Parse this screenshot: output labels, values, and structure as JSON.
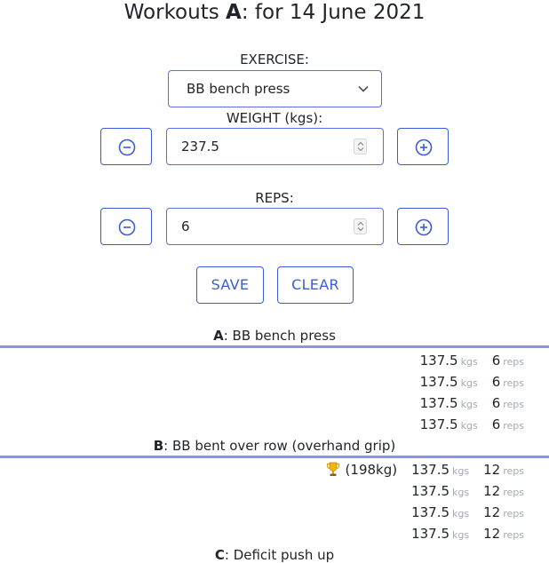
{
  "header": {
    "prefix": "Workouts ",
    "letter": "A",
    "suffix": ": for 14 June 2021"
  },
  "form": {
    "exercise_label": "EXERCISE:",
    "exercise_value": "BB bench press",
    "weight_label": "WEIGHT (kgs):",
    "weight_value": "237.5",
    "reps_label": "REPS:",
    "reps_value": "6",
    "save_label": "SAVE",
    "clear_label": "CLEAR"
  },
  "groups": [
    {
      "letter": "A",
      "name": ": BB bench press",
      "sets": [
        {
          "weight": "137.5",
          "weight_unit": "kgs",
          "reps": "6",
          "reps_unit": "reps"
        },
        {
          "weight": "137.5",
          "weight_unit": "kgs",
          "reps": "6",
          "reps_unit": "reps"
        },
        {
          "weight": "137.5",
          "weight_unit": "kgs",
          "reps": "6",
          "reps_unit": "reps"
        },
        {
          "weight": "137.5",
          "weight_unit": "kgs",
          "reps": "6",
          "reps_unit": "reps"
        }
      ]
    },
    {
      "letter": "B",
      "name": ": BB bent over row (overhand grip)",
      "personal_best": "(198kg)",
      "sets": [
        {
          "weight": "137.5",
          "weight_unit": "kgs",
          "reps": "12",
          "reps_unit": "reps"
        },
        {
          "weight": "137.5",
          "weight_unit": "kgs",
          "reps": "12",
          "reps_unit": "reps"
        },
        {
          "weight": "137.5",
          "weight_unit": "kgs",
          "reps": "12",
          "reps_unit": "reps"
        },
        {
          "weight": "137.5",
          "weight_unit": "kgs",
          "reps": "12",
          "reps_unit": "reps"
        }
      ]
    },
    {
      "letter": "C",
      "name": ": Deficit push up",
      "sets": []
    }
  ],
  "icons": {
    "minus": "minus-circle-icon",
    "plus": "plus-circle-icon",
    "trophy": "trophy-icon",
    "chevron": "chevron-down-icon"
  },
  "colors": {
    "accent": "#3b5bdb",
    "rule": "#8a93e8",
    "muted": "#a4aab0"
  }
}
